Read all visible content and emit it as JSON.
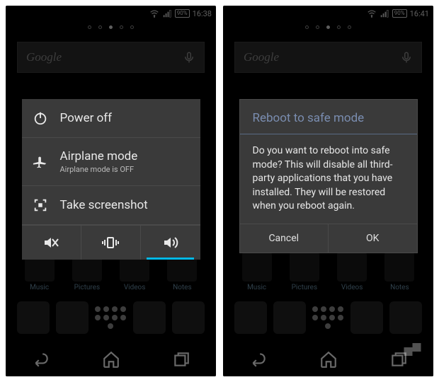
{
  "left": {
    "status": {
      "battery": "90%",
      "time": "16:38"
    },
    "search": {
      "placeholder": "Google"
    },
    "menu": {
      "power": "Power off",
      "airplane": "Airplane mode",
      "airplane_sub": "Airplane mode is OFF",
      "screenshot": "Take screenshot"
    },
    "shelf": [
      "Music",
      "Pictures",
      "Videos",
      "Notes"
    ]
  },
  "right": {
    "status": {
      "battery": "90%",
      "time": "16:41"
    },
    "search": {
      "placeholder": "Google"
    },
    "dialog": {
      "title": "Reboot to safe mode",
      "body": "Do you want to reboot into safe mode? This will disable all third-party applications that you have installed. They will be restored when you reboot again.",
      "cancel": "Cancel",
      "ok": "OK"
    },
    "shelf": [
      "Music",
      "Pictures",
      "Videos",
      "Notes"
    ]
  }
}
